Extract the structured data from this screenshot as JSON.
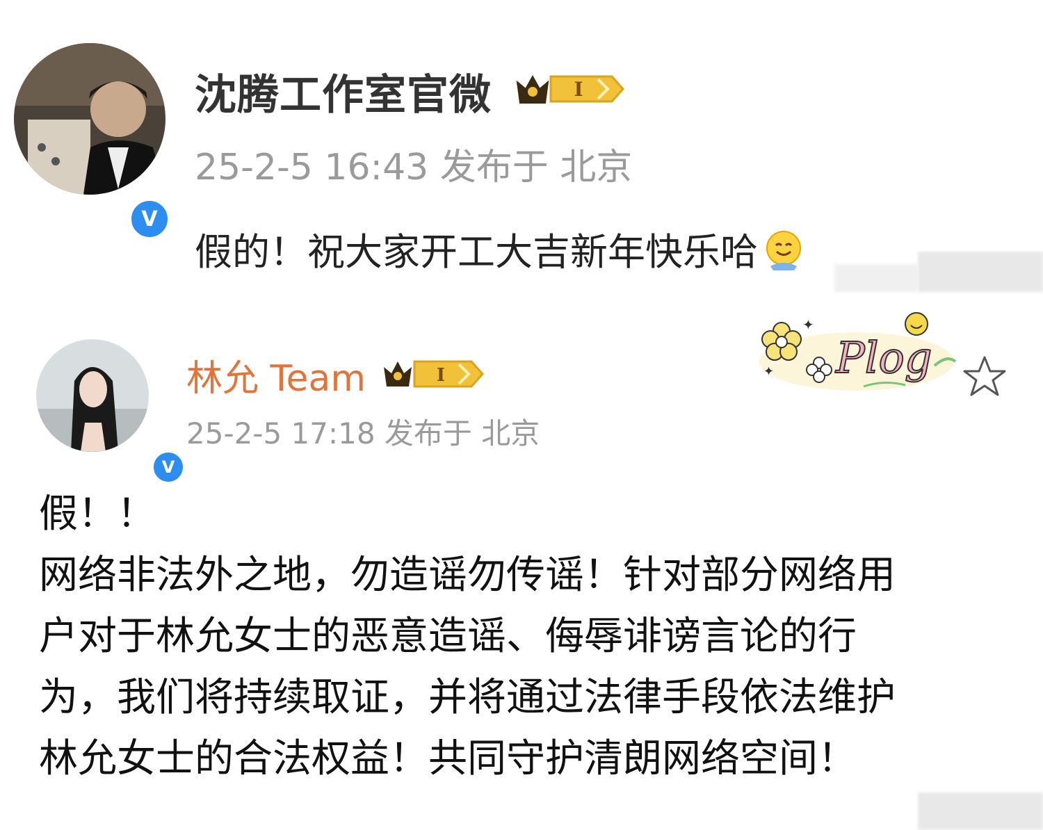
{
  "posts": [
    {
      "author": "沈腾工作室官微",
      "vip_level": "I",
      "meta": "25-2-5 16:43 发布于 北京",
      "text": "假的！祝大家开工大吉新年快乐哈",
      "emoji": "smile-emoji"
    },
    {
      "author": "林允 Team",
      "vip_level": "I",
      "meta": "25-2-5 17:18  发布于 北京",
      "text_lines": [
        "假！！",
        "网络非法外之地，勿造谣勿传谣！针对部分网络用",
        "户对于林允女士的恶意造谣、侮辱诽谤言论的行",
        "为，我们将持续取证，并将通过法律手段依法维护",
        "林允女士的合法权益！共同守护清朗网络空间！"
      ],
      "sticker": "Plog"
    }
  ],
  "colors": {
    "verified_badge": "#2e8ef0",
    "team_name": "#e0743a",
    "meta_gray": "#9a9a9a",
    "vip_gold": "#f2c13a"
  }
}
